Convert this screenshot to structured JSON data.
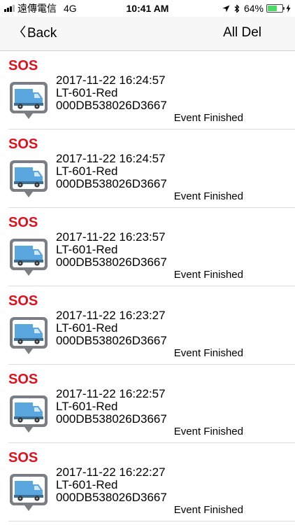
{
  "status_bar": {
    "carrier": "遠傳電信",
    "network": "4G",
    "time": "10:41 AM",
    "battery_percent": "64%",
    "battery_level": 0.64
  },
  "nav": {
    "back_label": "Back",
    "right_label": "All Del"
  },
  "events": [
    {
      "tag": "SOS",
      "datetime": "2017-11-22 16:24:57",
      "name": "LT-601-Red",
      "device_id": "000DB538026D3667",
      "status": "Event Finished"
    },
    {
      "tag": "SOS",
      "datetime": "2017-11-22 16:24:57",
      "name": "LT-601-Red",
      "device_id": "000DB538026D3667",
      "status": "Event Finished"
    },
    {
      "tag": "SOS",
      "datetime": "2017-11-22 16:23:57",
      "name": "LT-601-Red",
      "device_id": "000DB538026D3667",
      "status": "Event Finished"
    },
    {
      "tag": "SOS",
      "datetime": "2017-11-22 16:23:27",
      "name": "LT-601-Red",
      "device_id": "000DB538026D3667",
      "status": "Event Finished"
    },
    {
      "tag": "SOS",
      "datetime": "2017-11-22 16:22:57",
      "name": "LT-601-Red",
      "device_id": "000DB538026D3667",
      "status": "Event Finished"
    },
    {
      "tag": "SOS",
      "datetime": "2017-11-22 16:22:27",
      "name": "LT-601-Red",
      "device_id": "000DB538026D3667",
      "status": "Event Finished"
    }
  ],
  "colors": {
    "sos_red": "#e0101c",
    "truck_blue": "#5aa7e0",
    "badge_gray": "#7a7d84"
  },
  "icons": {
    "location": "location-arrow-icon",
    "bluetooth": "bluetooth-icon",
    "charging": "charging-bolt-icon",
    "back": "chevron-left-icon",
    "event": "truck-icon"
  }
}
